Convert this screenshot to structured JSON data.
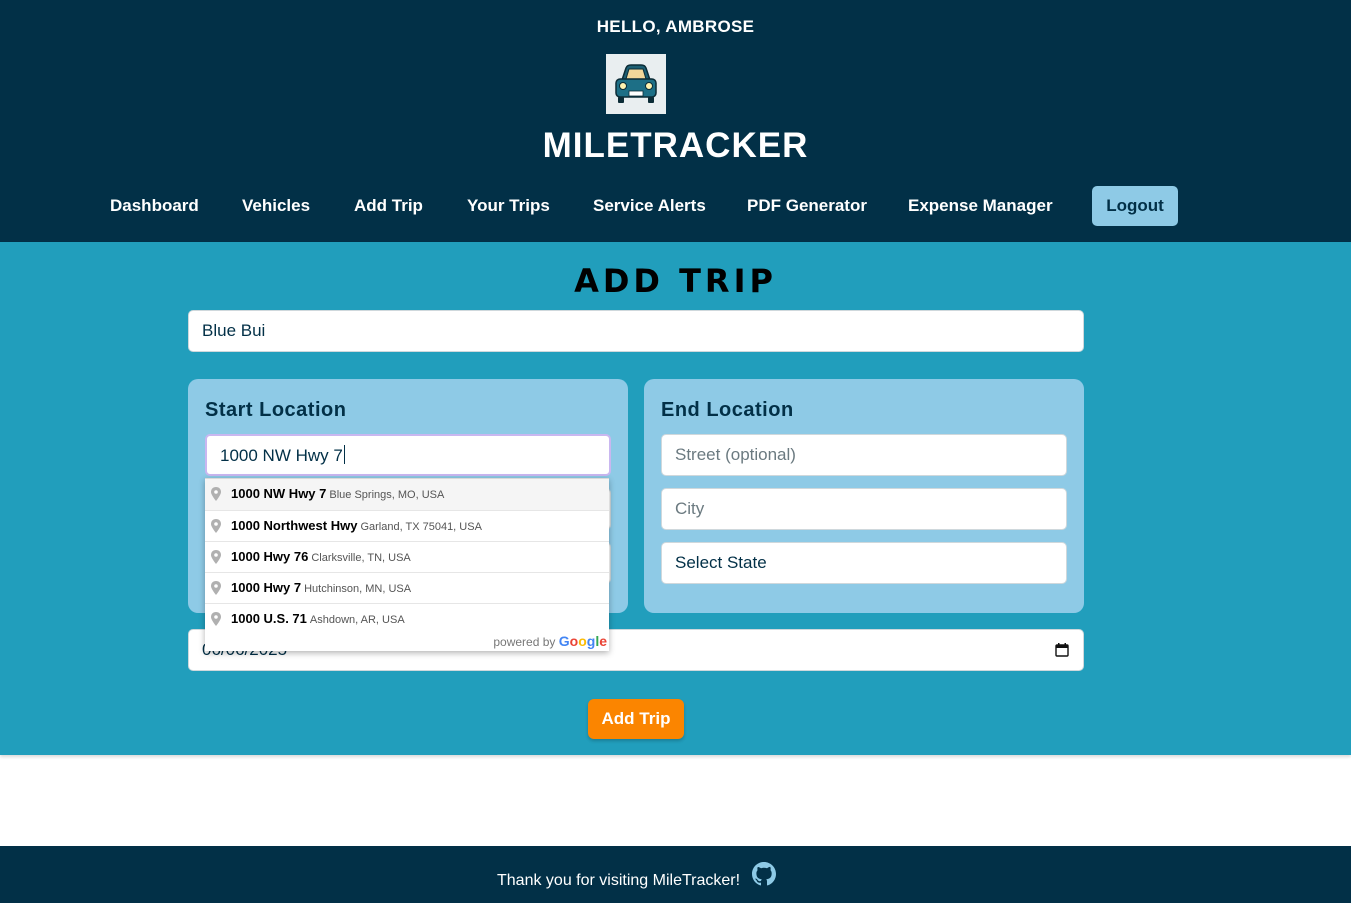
{
  "header": {
    "greeting": "HELLO, AMBROSE",
    "brand": "MILETRACKER",
    "logo_icon": "car-logo-icon"
  },
  "nav": {
    "items": [
      "Dashboard",
      "Vehicles",
      "Add Trip",
      "Your Trips",
      "Service Alerts",
      "PDF Generator",
      "Expense Manager"
    ],
    "logout": "Logout"
  },
  "page": {
    "title": "ADD TRIP",
    "vehicle_value": "Blue Bui",
    "start": {
      "title": "Start Location",
      "street_value": "1000 NW Hwy 7"
    },
    "end": {
      "title": "End Location",
      "street_placeholder": "Street (optional)",
      "city_placeholder": "City",
      "state_value": "Select State"
    },
    "date_value": "06/06/2025",
    "submit_label": "Add Trip"
  },
  "autocomplete": {
    "suggestions": [
      {
        "main": "1000 NW Hwy 7",
        "secondary": "Blue Springs, MO, USA"
      },
      {
        "main": "1000 Northwest Hwy",
        "secondary": "Garland, TX 75041, USA"
      },
      {
        "main": "1000 Hwy 76",
        "secondary": "Clarksville, TN, USA"
      },
      {
        "main": "1000 Hwy 7",
        "secondary": "Hutchinson, MN, USA"
      },
      {
        "main": "1000 U.S. 71",
        "secondary": "Ashdown, AR, USA"
      }
    ],
    "powered_prefix": "powered by",
    "powered_brand": "Google"
  },
  "footer": {
    "text": "Thank you for visiting MileTracker!",
    "icon": "github-icon"
  },
  "colors": {
    "header_bg": "#023047",
    "main_bg": "#219ebc",
    "card_bg": "#8ecae6",
    "accent": "#fb8500"
  }
}
